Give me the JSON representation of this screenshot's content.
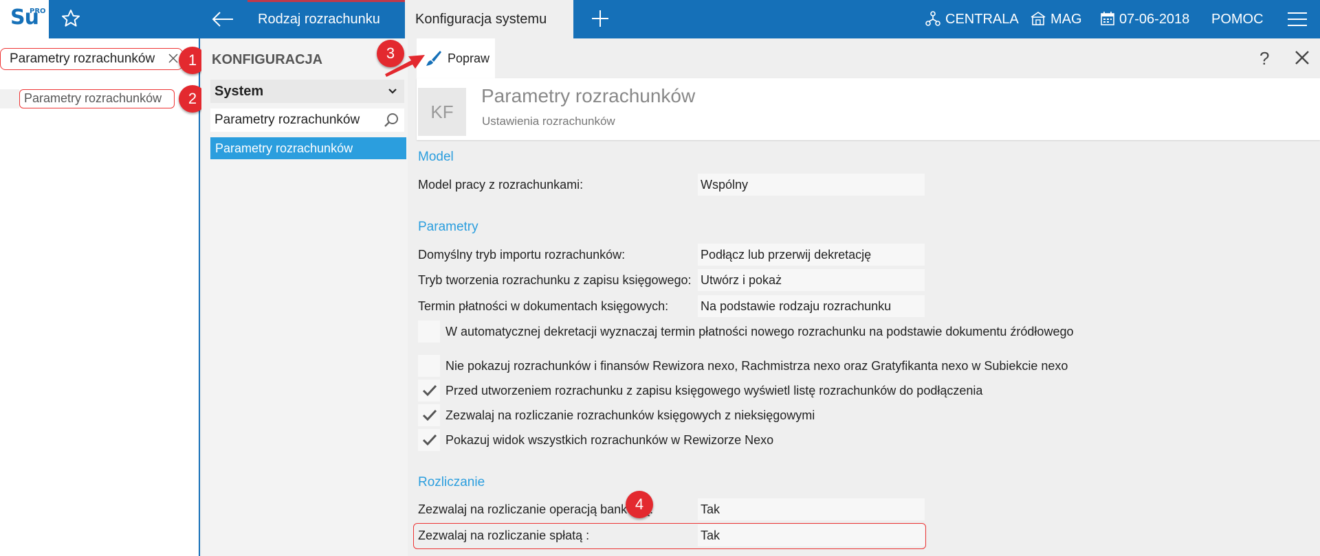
{
  "topbar": {
    "logo_text": "Su",
    "logo_badge": "PRO",
    "tabs": [
      {
        "label": "Rodzaj rozrachunku"
      },
      {
        "label": "Konfiguracja systemu"
      }
    ],
    "centrala": "CENTRALA",
    "mag": "MAG",
    "date": "07-06-2018",
    "pomoc": "POMOC"
  },
  "left": {
    "search_value": "Parametry rozrachunków",
    "result": "Parametry rozrachunków"
  },
  "mid": {
    "title": "KONFIGURACJA",
    "select_value": "System",
    "search_value": "Parametry rozrachunków",
    "selected_item": "Parametry rozrachunków"
  },
  "toolbar": {
    "popraw": "Popraw",
    "help": "?"
  },
  "header": {
    "badge": "KF",
    "title": "Parametry rozrachunków",
    "subtitle": "Ustawienia rozrachunków"
  },
  "sections": {
    "model": {
      "title": "Model",
      "rows": [
        {
          "label": "Model pracy z rozrachunkami:",
          "value": "Wspólny"
        }
      ]
    },
    "parametry": {
      "title": "Parametry",
      "rows": [
        {
          "label": "Domyślny tryb importu rozrachunków:",
          "value": "Podłącz lub przerwij dekretację"
        },
        {
          "label": "Tryb tworzenia rozrachunku z zapisu księgowego:",
          "value": "Utwórz i pokaż"
        },
        {
          "label": "Termin płatności w dokumentach księgowych:",
          "value": "Na podstawie rodzaju rozrachunku"
        }
      ],
      "checks": [
        {
          "label": "W automatycznej dekretacji wyznaczaj termin płatności nowego rozrachunku na podstawie dokumentu źródłowego",
          "checked": false
        },
        {
          "label": "Nie pokazuj rozrachunków i finansów Rewizora nexo, Rachmistrza nexo oraz Gratyfikanta nexo w Subiekcie nexo",
          "checked": false
        },
        {
          "label": "Przed utworzeniem rozrachunku z zapisu księgowego wyświetl listę rozrachunków do podłączenia",
          "checked": true
        },
        {
          "label": "Zezwalaj na rozliczanie rozrachunków księgowych z nieksięgowymi",
          "checked": true
        },
        {
          "label": "Pokazuj widok wszystkich rozrachunków w Rewizorze Nexo",
          "checked": true
        }
      ]
    },
    "rozliczanie": {
      "title": "Rozliczanie",
      "rows": [
        {
          "label": "Zezwalaj na rozliczanie operacją bankową:",
          "value": "Tak"
        },
        {
          "label": "Zezwalaj na rozliczanie spłatą :",
          "value": "Tak"
        }
      ]
    }
  },
  "badges": [
    "1",
    "2",
    "3",
    "4"
  ],
  "colors": {
    "brand": "#1570b8",
    "accent": "#2b9ede",
    "marker": "#e3292f"
  }
}
